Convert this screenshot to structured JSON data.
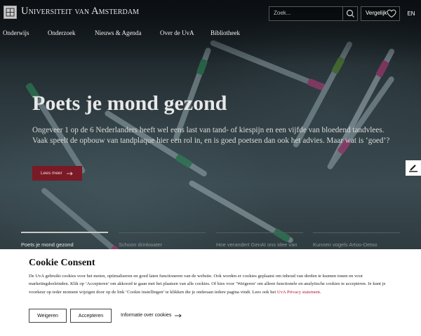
{
  "header": {
    "logo_title": "Universiteit van Amsterdam",
    "search_placeholder": "Zoek...",
    "compare_label": "Vergelijk",
    "language": "EN"
  },
  "nav": {
    "items": [
      "Onderwijs",
      "Onderzoek",
      "Nieuws & Agenda",
      "Over de UvA",
      "Bibliotheek"
    ]
  },
  "hero": {
    "title": "Poets je mond gezond",
    "text": "Ongeveer 1 op de 6 Nederlanders heeft wel eens last van tand- of kiespijn en een vijfde van bloedend tandvlees. Vaak speelt de opbouw van tandplaque hier een rol in, en is goed poetsen dan ook het advies. Maar wat is ‘goed’?",
    "button_label": "Lees meer"
  },
  "tabs": [
    "Poets je mond gezond",
    "Schoon drinkwater",
    "Hoe verandert GenAI ons idee van",
    "Kunnen vogels Artoo-Detoo"
  ],
  "cookie": {
    "title": "Cookie Consent",
    "text": "De UvA gebruikt cookies voor het meten, optimaliseren en goed laten functioneren van de website. Ook worden er cookies geplaatst om inhoud van derden te kunnen tonen en voor marketingdoeleinden. Klik op ‘Accepteren’ om akkoord te gaan met het plaatsen van alle cookies. Of kies voor ‘Weigeren’ om alleen functionele en analytische cookies te accepteren. Je kunt je voorkeur op ieder moment wijzigen door op de link ‘Cookie instellingen’ te klikken die je onderaan iedere pagina vindt. Lees ook het",
    "link_text": "UvA Privacy statement",
    "refuse_label": "Weigeren",
    "accept_label": "Accepteren",
    "info_label": "Informatie over cookies"
  },
  "colors": {
    "brand_red": "#7a1a26",
    "link_red": "#b2102f"
  }
}
